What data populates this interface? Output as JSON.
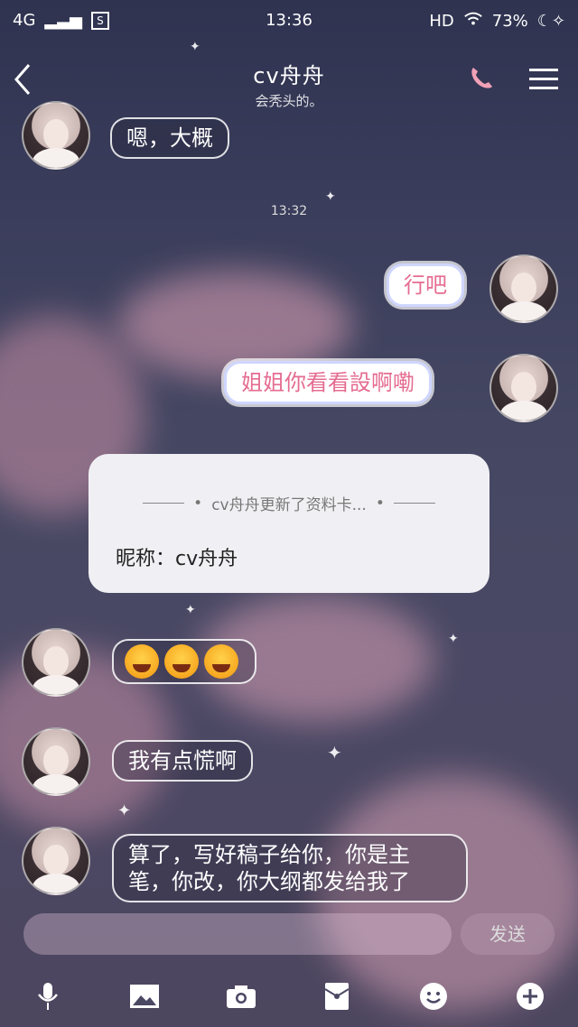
{
  "status_bar": {
    "network": "4G",
    "sim_label": "S",
    "time": "13:36",
    "hd": "HD",
    "battery": "73%"
  },
  "header": {
    "title": "cv舟舟",
    "subtitle": "会秃头的。"
  },
  "messages": [
    {
      "side": "left",
      "text": "嗯，大概"
    },
    {
      "timestamp": "13:32"
    },
    {
      "side": "right",
      "text": "行吧"
    },
    {
      "side": "right",
      "text": "姐姐你看看設啊嘞"
    },
    {
      "card": {
        "header": "cv舟舟更新了资料卡...",
        "body": "昵称：cv舟舟"
      }
    },
    {
      "side": "left",
      "type": "emoji",
      "count": 3
    },
    {
      "side": "left",
      "text": "我有点慌啊"
    },
    {
      "side": "left",
      "text": "算了，写好稿子给你，你是主笔，你改，你大纲都发给我了"
    }
  ],
  "input": {
    "placeholder": "",
    "send_label": "发送"
  },
  "toolbar": [
    "microphone-icon",
    "image-icon",
    "camera-icon",
    "red-packet-icon",
    "emoji-icon",
    "plus-icon"
  ]
}
